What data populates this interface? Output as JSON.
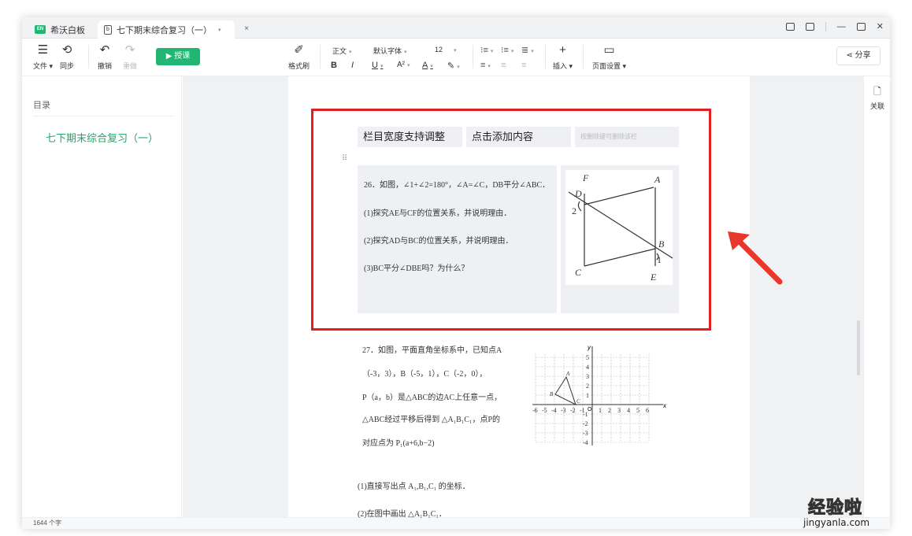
{
  "tabs": {
    "home_label": "希沃白板",
    "doc_label": "七下期末综合复习（一）",
    "doc_caret": "▾",
    "close": "×"
  },
  "toolbar": {
    "file": "文件",
    "sync": "同步",
    "undo": "撤销",
    "redo": "重做",
    "teach": "▶ 授课",
    "format_painter": "格式刷",
    "style": "正文",
    "font": "默认字体",
    "size": "12",
    "bold": "B",
    "italic": "I",
    "underline": "U",
    "superscript": "A²",
    "fontcolor": "A",
    "insert": "插入",
    "page_setup": "页面设置",
    "share": "分享"
  },
  "sidebar": {
    "title": "目录",
    "items": [
      {
        "label": "七下期末综合复习（一）"
      }
    ]
  },
  "rightbar": {
    "related": "关联"
  },
  "columns": {
    "h1": "栏目宽度支持调整",
    "h2": "点击添加内容",
    "h3": "按删除键可删除该栏"
  },
  "question26": {
    "stem": "26．如图，∠1+∠2=180°，∠A=∠C，DB平分∠ABC．",
    "p1": "(1)探究AE与CF的位置关系，并说明理由．",
    "p2": "(2)探究AD与BC的位置关系，并说明理由．",
    "p3": "(3)BC平分∠DBE吗？为什么？",
    "fig_labels": {
      "F": "F",
      "A": "A",
      "D": "D",
      "two": "2",
      "B": "B",
      "one": "1",
      "C": "C",
      "E": "E"
    }
  },
  "question27": {
    "l1": "27．如图，平面直角坐标系中，已知点A",
    "l2": "（-3，3），B（-5，1），C（-2，0），",
    "l3": "P（a，b）是△ABC的边AC上任意一点，",
    "l4": "△ABC经过平移后得到 △A₁B₁C₁，点P的",
    "l5": "对应点为 P₁(a+6,b−2)",
    "l6": "(1)直接写出点 A₁,B₁,C₁ 的坐标．",
    "l7": "(2)在图中画出 △A₁B₁C₁．",
    "x_ticks": [
      "-6",
      "-5",
      "-4",
      "-3",
      "-2",
      "-1",
      "1",
      "2",
      "3",
      "4",
      "5",
      "6"
    ],
    "y_ticks": [
      "5",
      "4",
      "3",
      "2",
      "1",
      "-1",
      "-2",
      "-3",
      "-4"
    ],
    "axis_x": "x",
    "axis_y": "y",
    "origin": "O"
  },
  "status": {
    "word_count": "1644 个字"
  },
  "watermark": {
    "line1": "经验啦",
    "line2": "jingyanla.com"
  },
  "colors": {
    "accent": "#22b573",
    "highlight": "#e02020"
  }
}
